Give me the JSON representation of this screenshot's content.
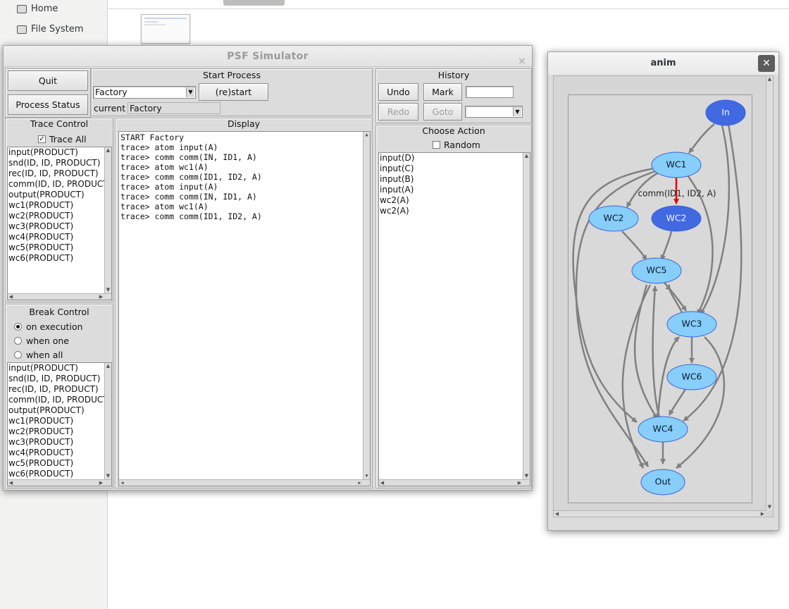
{
  "desktop": {
    "places": [
      "Home",
      "File System"
    ]
  },
  "psf": {
    "title": "PSF Simulator",
    "close": "×",
    "quit_label": "Quit",
    "process_status_label": "Process Status",
    "start_process": {
      "header": "Start Process",
      "process_value": "Factory",
      "restart_label": "(re)start",
      "current_label": "current",
      "current_value": "Factory"
    },
    "history": {
      "header": "History",
      "undo_label": "Undo",
      "mark_label": "Mark",
      "mark_value": "",
      "redo_label": "Redo",
      "goto_label": "Goto",
      "goto_value": ""
    },
    "trace_control": {
      "header": "Trace Control",
      "trace_all_label": "Trace All",
      "trace_all_checked": true,
      "items": [
        "input(PRODUCT)",
        "snd(ID, ID, PRODUCT)",
        "rec(ID, ID, PRODUCT)",
        "comm(ID, ID, PRODUCT)",
        "output(PRODUCT)",
        "wc1(PRODUCT)",
        "wc2(PRODUCT)",
        "wc3(PRODUCT)",
        "wc4(PRODUCT)",
        "wc5(PRODUCT)",
        "wc6(PRODUCT)"
      ]
    },
    "break_control": {
      "header": "Break Control",
      "options": [
        "on execution",
        "when one",
        "when all"
      ],
      "selected": "on execution",
      "items": [
        "input(PRODUCT)",
        "snd(ID, ID, PRODUCT)",
        "rec(ID, ID, PRODUCT)",
        "comm(ID, ID, PRODUCT)",
        "output(PRODUCT)",
        "wc1(PRODUCT)",
        "wc2(PRODUCT)",
        "wc3(PRODUCT)",
        "wc4(PRODUCT)",
        "wc5(PRODUCT)",
        "wc6(PRODUCT)"
      ]
    },
    "display": {
      "header": "Display",
      "lines": [
        "START Factory",
        "trace> atom input(A)",
        "trace> comm comm(IN, ID1, A)",
        "trace> atom wc1(A)",
        "trace> comm comm(ID1, ID2, A)",
        "trace> atom input(A)",
        "trace> comm comm(IN, ID1, A)",
        "trace> atom wc1(A)",
        "trace> comm comm(ID1, ID2, A)"
      ]
    },
    "choose_action": {
      "header": "Choose Action",
      "random_label": "Random",
      "random_checked": false,
      "items": [
        "input(D)",
        "input(C)",
        "input(B)",
        "input(A)",
        "wc2(A)",
        "wc2(A)"
      ]
    }
  },
  "anim": {
    "title": "anim",
    "close": "✕",
    "edge_label": "comm(ID1, ID2, A)",
    "nodes": {
      "in": "In",
      "wc1": "WC1",
      "wc2a": "WC2",
      "wc2b": "WC2",
      "wc5": "WC5",
      "wc3": "WC3",
      "wc6": "WC6",
      "wc4": "WC4",
      "out": "Out"
    },
    "colors": {
      "active": "#4169e1",
      "inactive": "#87cefa",
      "edge": "#808080",
      "highlight": "#ff0000"
    }
  }
}
